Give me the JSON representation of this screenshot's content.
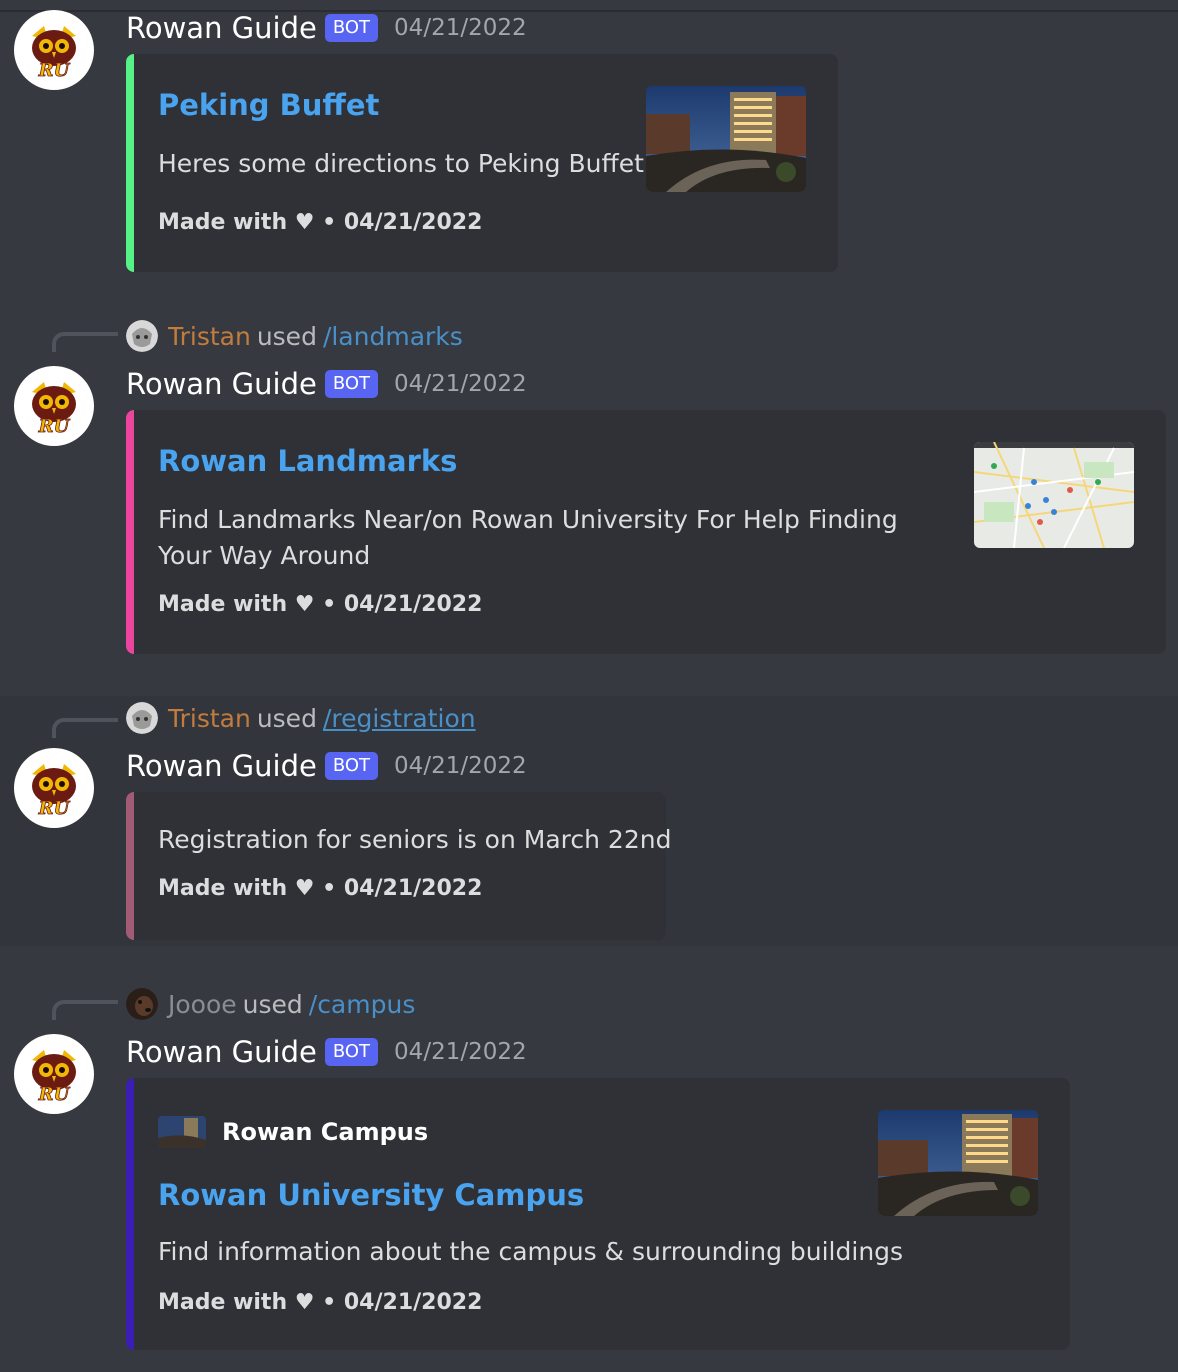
{
  "bot": {
    "name": "Rowan Guide",
    "badge": "BOT",
    "logo_text": "RU"
  },
  "colors": {
    "background": "#36393f",
    "embed_bg": "#2f3136",
    "link": "#4aa3ef",
    "badge": "#5865f2",
    "peking_accent": "#57f287",
    "landmarks_accent": "#eb459e",
    "registration_accent": "#a15b74",
    "campus_accent": "#3b1fb5"
  },
  "messages": [
    {
      "timestamp": "04/21/2022",
      "embed": {
        "title": "Peking Buffet",
        "description": "Heres some directions to Peking Buffet!",
        "footer": "Made with ♥ • 04/21/2022",
        "thumbnail": "campus-night-photo"
      }
    },
    {
      "reply": {
        "user": "Tristan",
        "used": "used",
        "command": "/landmarks"
      },
      "timestamp": "04/21/2022",
      "embed": {
        "title": "Rowan Landmarks",
        "description": "Find Landmarks Near/on Rowan University For Help Finding Your Way Around",
        "footer": "Made with ♥ • 04/21/2022",
        "thumbnail": "map-screenshot"
      }
    },
    {
      "reply": {
        "user": "Tristan",
        "used": "used",
        "command": "/registration"
      },
      "timestamp": "04/21/2022",
      "embed": {
        "description": "Registration for seniors is on March 22nd",
        "footer": "Made with ♥ • 04/21/2022"
      }
    },
    {
      "reply": {
        "user": "Joooe",
        "used": "used",
        "command": "/campus"
      },
      "timestamp": "04/21/2022",
      "embed": {
        "author": "Rowan Campus",
        "title": "Rowan University Campus",
        "description": "Find information about the campus & surrounding buildings",
        "footer": "Made with ♥ • 04/21/2022",
        "thumbnail": "campus-night-photo"
      }
    }
  ]
}
